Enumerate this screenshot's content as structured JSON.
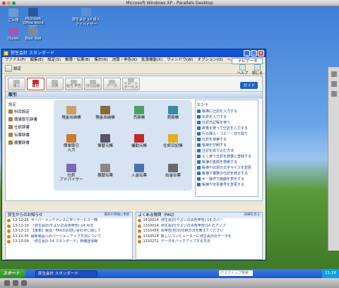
{
  "host": {
    "title": "Microsoft Windows XP - Parallels Desktop"
  },
  "desktop_icons": [
    {
      "label": "ごみ箱",
      "color": "#6b9bd1"
    },
    {
      "label": "Microsoft Office Word 2007",
      "color": "#2b579a"
    },
    {
      "label": "弥生会計 14 導入アドバイザー",
      "color": "#5a8fd6"
    },
    {
      "label": "iTunes",
      "color": "#9b59b6"
    },
    {
      "label": "Boot Tool",
      "color": "#7a8aa0"
    }
  ],
  "window": {
    "title": "弥生会計 スタンダード",
    "menu": [
      "ファイル(F)",
      "編集(E)",
      "設定(S)",
      "帳簿・伝票(B)",
      "集計(R)",
      "決算・申告(K)",
      "拡張機能(X)",
      "ウィンドウ(W)",
      "オプション(O)",
      "ヘルプ(H)"
    ],
    "navigator_label": "ナビゲータ",
    "toolbar": {
      "home_label": "設定"
    },
    "right_tools": [
      "ヘルプ",
      "閉じる"
    ]
  },
  "tabs": [
    "導入",
    "取引",
    "決算",
    "給与 申告",
    "日付記録",
    "データ",
    "サポート サービス"
  ],
  "guide_label": "ガイド",
  "section_title": "取引",
  "settings": {
    "header": "設定",
    "items": [
      "科目設定",
      "簡単取引辞書",
      "仕訳辞書",
      "伝票辞書",
      "摘要辞書"
    ]
  },
  "grid_items": [
    {
      "label": "現金出納帳",
      "color": "#c8a060"
    },
    {
      "label": "預金出納帳",
      "color": "#8a6a3a"
    },
    {
      "label": "売掛帳",
      "color": "#4aa060"
    },
    {
      "label": "買掛帳",
      "color": "#3a8aa0"
    },
    {
      "label": "簡単取引\n入力",
      "color": "#d07a30"
    },
    {
      "label": "振替元帳",
      "color": "#555566"
    },
    {
      "label": "補助元帳",
      "color": "#c02a2a"
    },
    {
      "label": "仕訳日記帳",
      "color": "#e0b020"
    },
    {
      "label": "仕訳\nアドバイザー",
      "color": "#7a6ab0"
    },
    {
      "label": "振替伝票",
      "color": "#888888"
    },
    {
      "label": "入金伝票",
      "color": "#4a70b0"
    },
    {
      "label": "出金伝票",
      "color": "#6a6a6a"
    }
  ],
  "hints": {
    "header": "ヒント",
    "items": [
      "帳簿に仕訳を入力する",
      "伝票を入力する",
      "仕訳日記帳を使う",
      "辞書を使って仕訳を入力する",
      "行の挿入・コピー・切り取り",
      "仕訳を検索する",
      "帳簿を印刷する",
      "仕訳を絞り込む方法",
      "よく使う仕訳を辞書に登録する",
      "帳簿の金額を検索する",
      "帳簿や伝票の文字サイズを変更",
      "帳簿で複数の仕訳を修正する",
      "キー操作で画面を表示する",
      "帳簿や伝票番号を変更する"
    ]
  },
  "news": {
    "header": "弥生からのお知らせ",
    "more": "最新の情報に更新",
    "rows": [
      {
        "date": "13-12-26",
        "text": "サーバーメンテナンスに伴うサービス一時"
      },
      {
        "date": "13-12-19",
        "text": "「弥生会計(やよいの青色申告) 14 月次"
      },
      {
        "date": "13-12-13",
        "text": "【重要】電話・FAXのお問い合わせに関して"
      },
      {
        "date": "13-12-05",
        "text": "最新製品へのバージョンアップ方法について"
      },
      {
        "date": "13-10-09",
        "text": "「弥生会計 14 スタンダード」新機能情報"
      }
    ]
  },
  "faq": {
    "header": "よくある質問（FAQ）",
    "more": "詳細を見る",
    "rows": [
      {
        "date": "1410014",
        "text": "弥生会計(やよいの青色申告) 14 のバー"
      },
      {
        "date": "1310014",
        "text": "弥生会計(やよいの青色申告)14 のアップ"
      },
      {
        "date": "1310456",
        "text": "青申告(控)の印刷方法を教えてください"
      },
      {
        "date": "1310528",
        "text": "新しいコンピューターに弥生会計のデータを"
      },
      {
        "date": "1310272",
        "text": "データをバックアップする方法"
      }
    ]
  },
  "taskbar": {
    "start": "スタート",
    "task": "弥生会計 スタンダード",
    "search_placeholder": "デスクトップ検索",
    "time": "21:16"
  }
}
